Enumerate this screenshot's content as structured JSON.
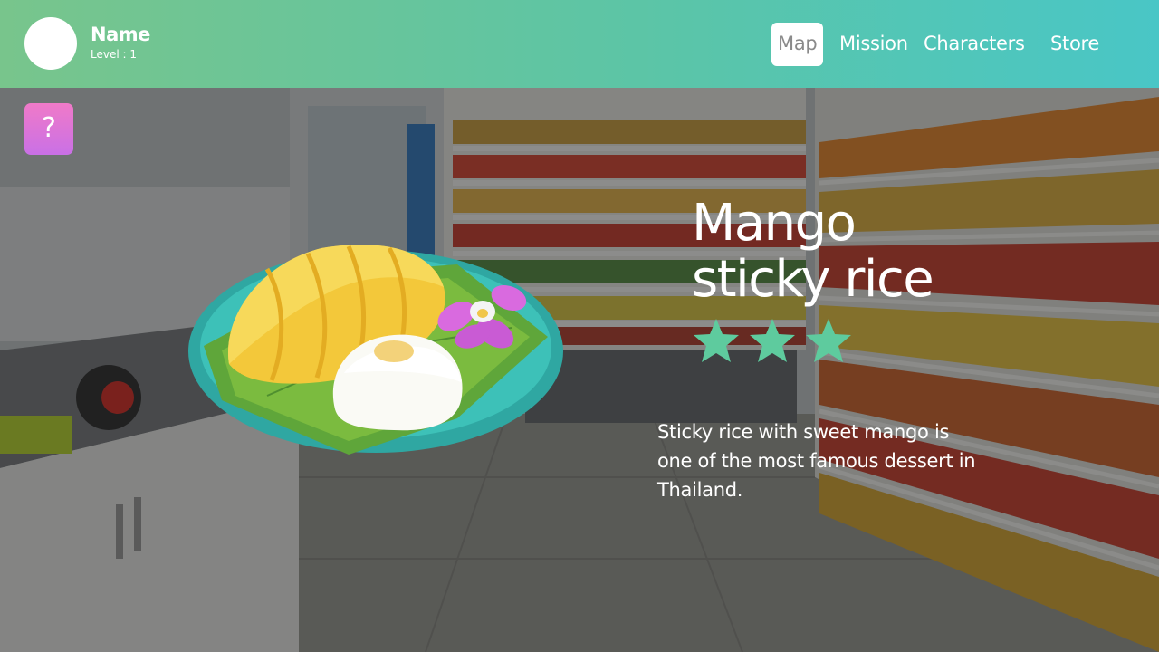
{
  "player": {
    "name": "Name",
    "level": "Level : 1"
  },
  "nav": {
    "map": "Map",
    "mission": "Mission",
    "characters": "Characters",
    "store": "Store",
    "active": "Map"
  },
  "help": {
    "label": "?"
  },
  "food": {
    "title": "Mango sticky rice",
    "rating": 3,
    "description": "Sticky rice with sweet mango is one of the most famous dessert in Thailand."
  },
  "colors": {
    "header_start": "#78c58c",
    "header_end": "#49c6c6",
    "star": "#5ecb9e",
    "help_button": "#e176d6"
  },
  "icons": {
    "help": "question-mark-icon",
    "star": "star-icon"
  }
}
